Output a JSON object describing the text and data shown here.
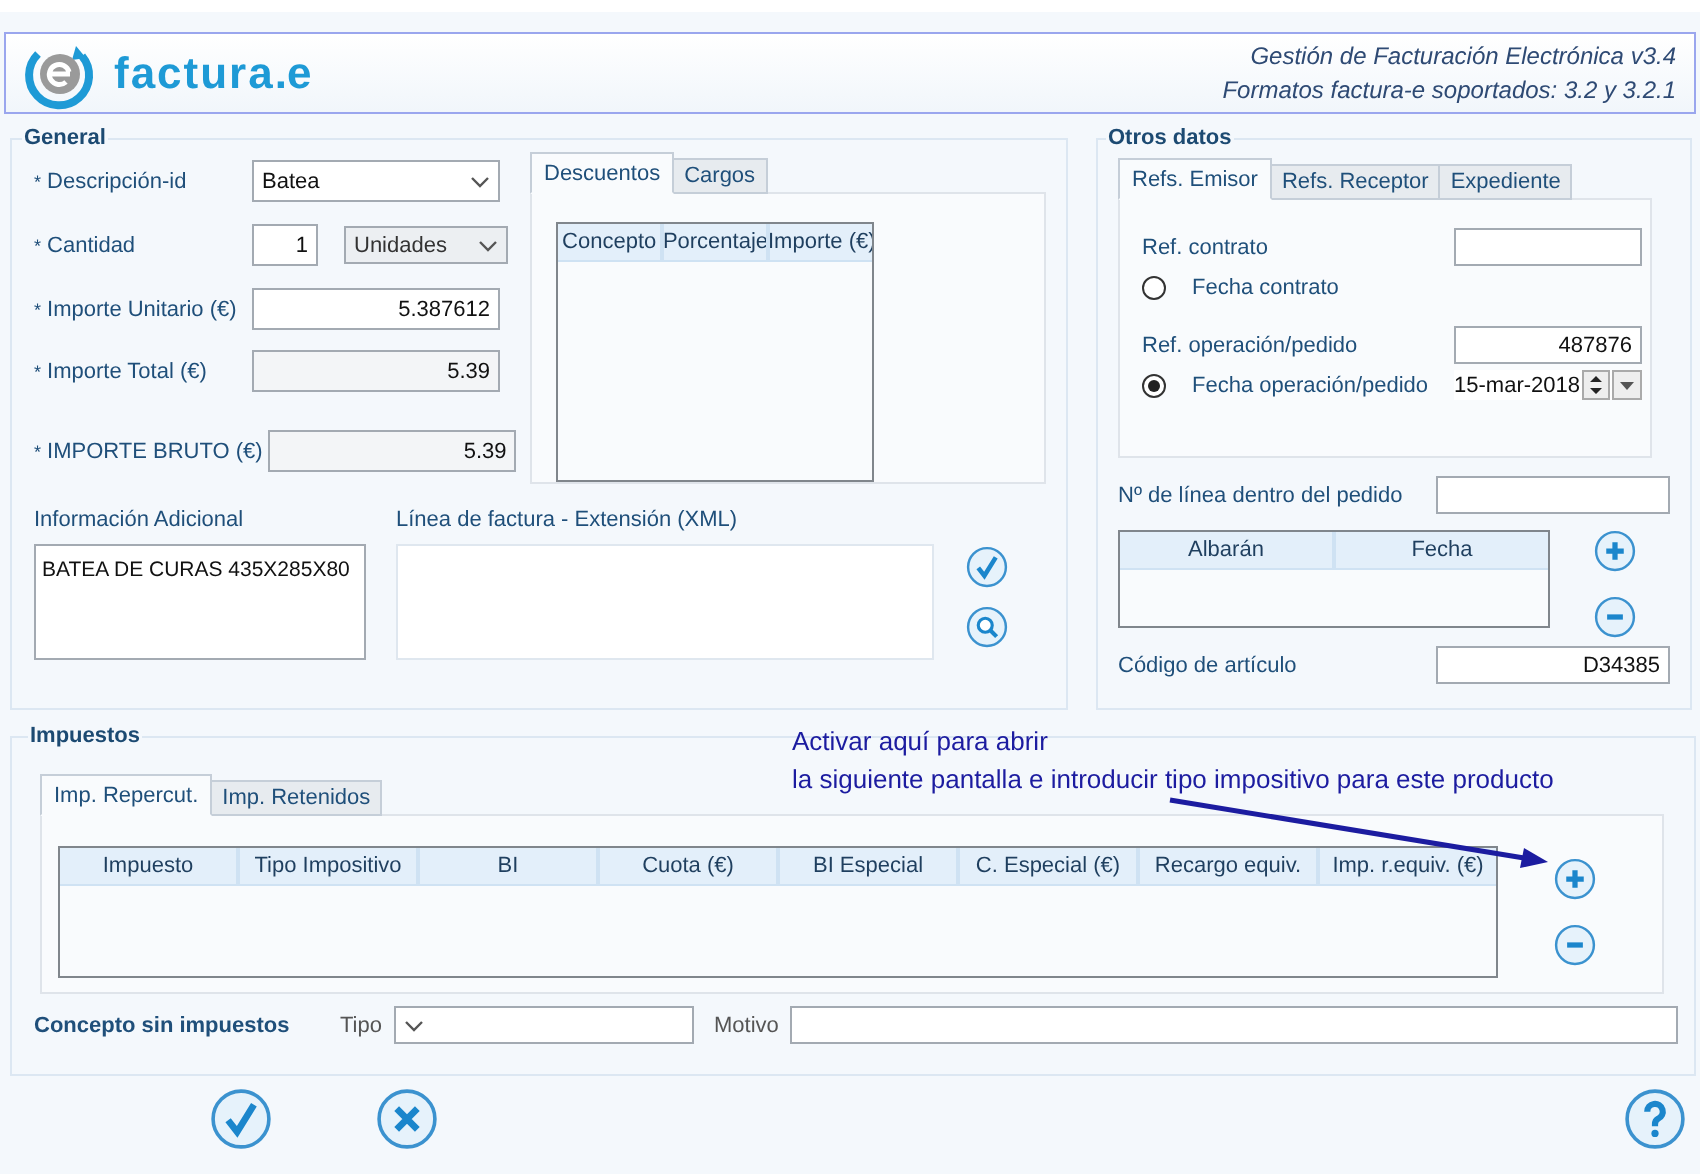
{
  "header": {
    "brand": "factura",
    "brand_suffix": ".e",
    "lines": [
      "Gestión de Facturación Electrónica v3.4",
      "Formatos factura-e soportados: 3.2 y 3.2.1"
    ]
  },
  "general": {
    "title": "General",
    "fields": [
      {
        "kind": "select",
        "mark": "*",
        "label": "Descripción-id",
        "value": "Batea"
      },
      {
        "kind": "quantity",
        "mark": "*",
        "label": "Cantidad",
        "value": "1",
        "unit": "Unidades",
        "unit_disabled": true
      },
      {
        "kind": "input",
        "mark": "*",
        "label": "Importe Unitario (€)",
        "value": "5.387612",
        "readonly": false
      },
      {
        "kind": "input",
        "mark": "*",
        "label": "Importe Total (€)",
        "value": "5.39",
        "readonly": true
      },
      {
        "kind": "input",
        "mark": "*",
        "label": "IMPORTE BRUTO (€)",
        "value": "5.39",
        "readonly": true
      }
    ],
    "tabs": [
      {
        "label": "Descuentos",
        "selected": true
      },
      {
        "label": "Cargos",
        "selected": false
      }
    ],
    "columns": [
      "Concepto",
      "Porcentaje",
      "Importe (€)"
    ],
    "info": {
      "label": "Información Adicional",
      "value": "BATEA DE CURAS 435X285X80"
    },
    "xml": {
      "label": "Línea de factura - Extensión (XML)"
    }
  },
  "otros": {
    "title": "Otros datos",
    "tabs": [
      {
        "label": "Refs. Emisor",
        "selected": true
      },
      {
        "label": "Refs. Receptor",
        "selected": false
      },
      {
        "label": "Expediente",
        "selected": false
      }
    ],
    "refs": [
      {
        "kind": "input",
        "label": "Ref. contrato"
      },
      {
        "kind": "radio",
        "label": "Fecha contrato",
        "selected": false
      },
      {
        "kind": "input",
        "label": "Ref. operación/pedido",
        "value": "487876"
      },
      {
        "kind": "radio",
        "label": "Fecha operación/pedido",
        "selected": true,
        "date": "15-mar-2018"
      }
    ],
    "line": {
      "label": "Nº de línea dentro del pedido"
    },
    "columns": [
      "Albarán",
      "Fecha"
    ],
    "article": {
      "label": "Código de artículo",
      "value": "D34385"
    }
  },
  "impuestos": {
    "title": "Impuestos",
    "tabs": [
      {
        "label": "Imp. Repercut.",
        "selected": true
      },
      {
        "label": "Imp. Retenidos",
        "selected": false
      }
    ],
    "columns": [
      "Impuesto",
      "Tipo Impositivo",
      "BI",
      "Cuota (€)",
      "BI Especial",
      "C. Especial (€)",
      "Recargo equiv.",
      "Imp. r.equiv. (€)"
    ],
    "exempt": {
      "label": "Concepto sin impuestos",
      "type_label": "Tipo",
      "reason_label": "Motivo"
    }
  },
  "annotation": {
    "lines": [
      "Activar aquí para abrir",
      "la siguiente pantalla e introducir tipo impositivo para este producto"
    ]
  }
}
